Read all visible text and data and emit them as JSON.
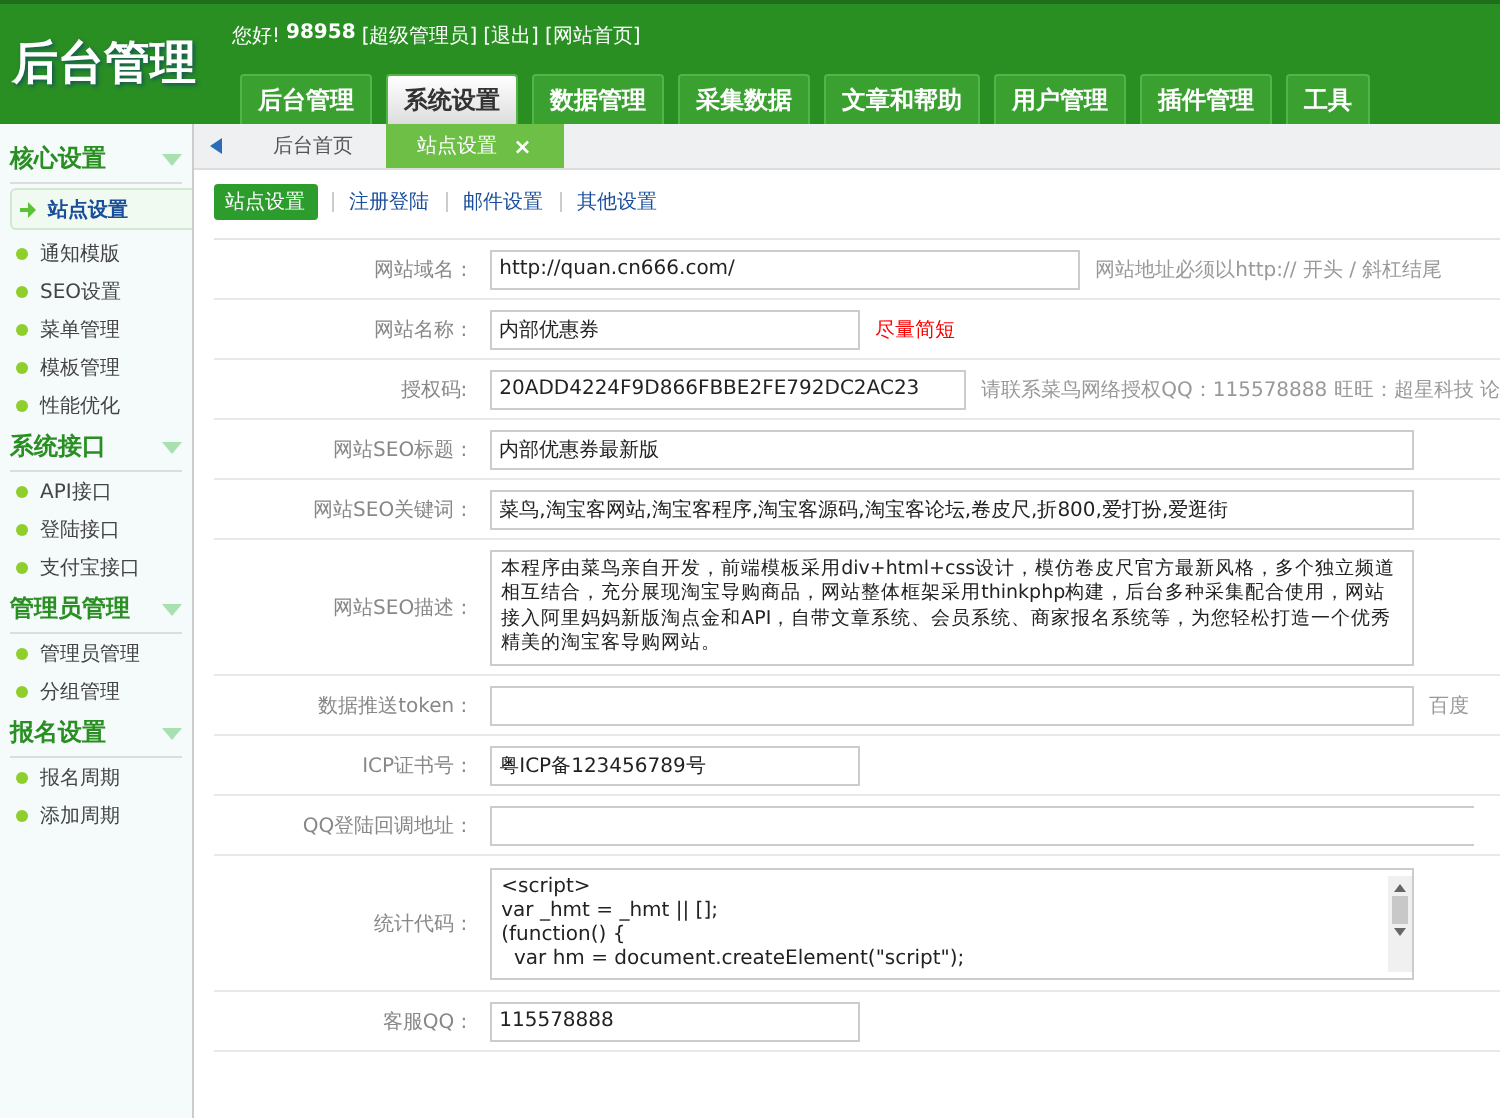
{
  "header": {
    "logo": "后台管理",
    "greeting": "您好!",
    "user": "98958",
    "role": "[超级管理员]",
    "links": [
      "[退出]",
      "[网站首页]"
    ]
  },
  "nav": [
    {
      "label": "后台管理",
      "selected": false
    },
    {
      "label": "系统设置",
      "selected": true
    },
    {
      "label": "数据管理",
      "selected": false
    },
    {
      "label": "采集数据",
      "selected": false
    },
    {
      "label": "文章和帮助",
      "selected": false
    },
    {
      "label": "用户管理",
      "selected": false
    },
    {
      "label": "插件管理",
      "selected": false
    },
    {
      "label": "工具",
      "selected": false
    }
  ],
  "sidebar": [
    {
      "title": "核心设置",
      "items": [
        {
          "label": "站点设置",
          "selected": true
        },
        {
          "label": "通知模版",
          "selected": false
        },
        {
          "label": "SEO设置",
          "selected": false
        },
        {
          "label": "菜单管理",
          "selected": false
        },
        {
          "label": "模板管理",
          "selected": false
        },
        {
          "label": "性能优化",
          "selected": false
        }
      ]
    },
    {
      "title": "系统接口",
      "items": [
        {
          "label": "API接口",
          "selected": false
        },
        {
          "label": "登陆接口",
          "selected": false
        },
        {
          "label": "支付宝接口",
          "selected": false
        }
      ]
    },
    {
      "title": "管理员管理",
      "items": [
        {
          "label": "管理员管理",
          "selected": false
        },
        {
          "label": "分组管理",
          "selected": false
        }
      ]
    },
    {
      "title": "报名设置",
      "items": [
        {
          "label": "报名周期",
          "selected": false
        },
        {
          "label": "添加周期",
          "selected": false
        }
      ]
    }
  ],
  "page_tabs": [
    {
      "label": "后台首页",
      "selected": false
    },
    {
      "label": "站点设置",
      "selected": true,
      "close": "×"
    }
  ],
  "subnav": [
    {
      "label": "站点设置",
      "selected": true
    },
    {
      "label": "注册登陆",
      "selected": false
    },
    {
      "label": "邮件设置",
      "selected": false
    },
    {
      "label": "其他设置",
      "selected": false
    }
  ],
  "form": [
    {
      "label": "网站域名 :",
      "kind": "input",
      "value": "http://quan.cn666.com/",
      "hint": "网站地址必须以http:// 开头 / 斜杠结尾",
      "hint_warning": false
    },
    {
      "label": "网站名称 :",
      "kind": "input",
      "value": "内部优惠券",
      "hint": "尽量简短",
      "hint_warning": true
    },
    {
      "label": "授权码:",
      "kind": "input",
      "value": "20ADD4224F9D866FBBE2FE792DC2AC23",
      "hint": "请联系菜鸟网络授权QQ：115578888 旺旺：超星科技 论",
      "hint_warning": false
    },
    {
      "label": "网站SEO标题 :",
      "kind": "input",
      "value": "内部优惠券最新版"
    },
    {
      "label": "网站SEO关键词 :",
      "kind": "input",
      "value": "菜鸟,淘宝客网站,淘宝客程序,淘宝客源码,淘宝客论坛,卷皮尺,折800,爱打扮,爱逛街"
    },
    {
      "label": "网站SEO描述 :",
      "kind": "textarea",
      "value": "本程序由菜鸟亲自开发，前端模板采用div+html+css设计，模仿卷皮尺官方最新风格，多个独立频道相互结合，充分展现淘宝导购商品，网站整体框架采用thinkphp构建，后台多种采集配合使用，网站接入阿里妈妈新版淘点金和API，自带文章系统、会员系统、商家报名系统等，为您轻松打造一个优秀精美的淘宝客导购网站。"
    },
    {
      "label": "数据推送token :",
      "kind": "input",
      "hint": "百度",
      "hint_warning": false
    },
    {
      "label": "ICP证书号 :",
      "kind": "input",
      "value": "粤ICP备123456789号"
    },
    {
      "label": "QQ登陆回调地址 :",
      "kind": "input"
    },
    {
      "label": "统计代码 :",
      "kind": "code",
      "value": "<script>\nvar _hmt = _hmt || [];\n(function() {\n  var hm = document.createElement(\"script\");"
    },
    {
      "label": "客服QQ :",
      "kind": "input",
      "value": "115578888"
    }
  ]
}
